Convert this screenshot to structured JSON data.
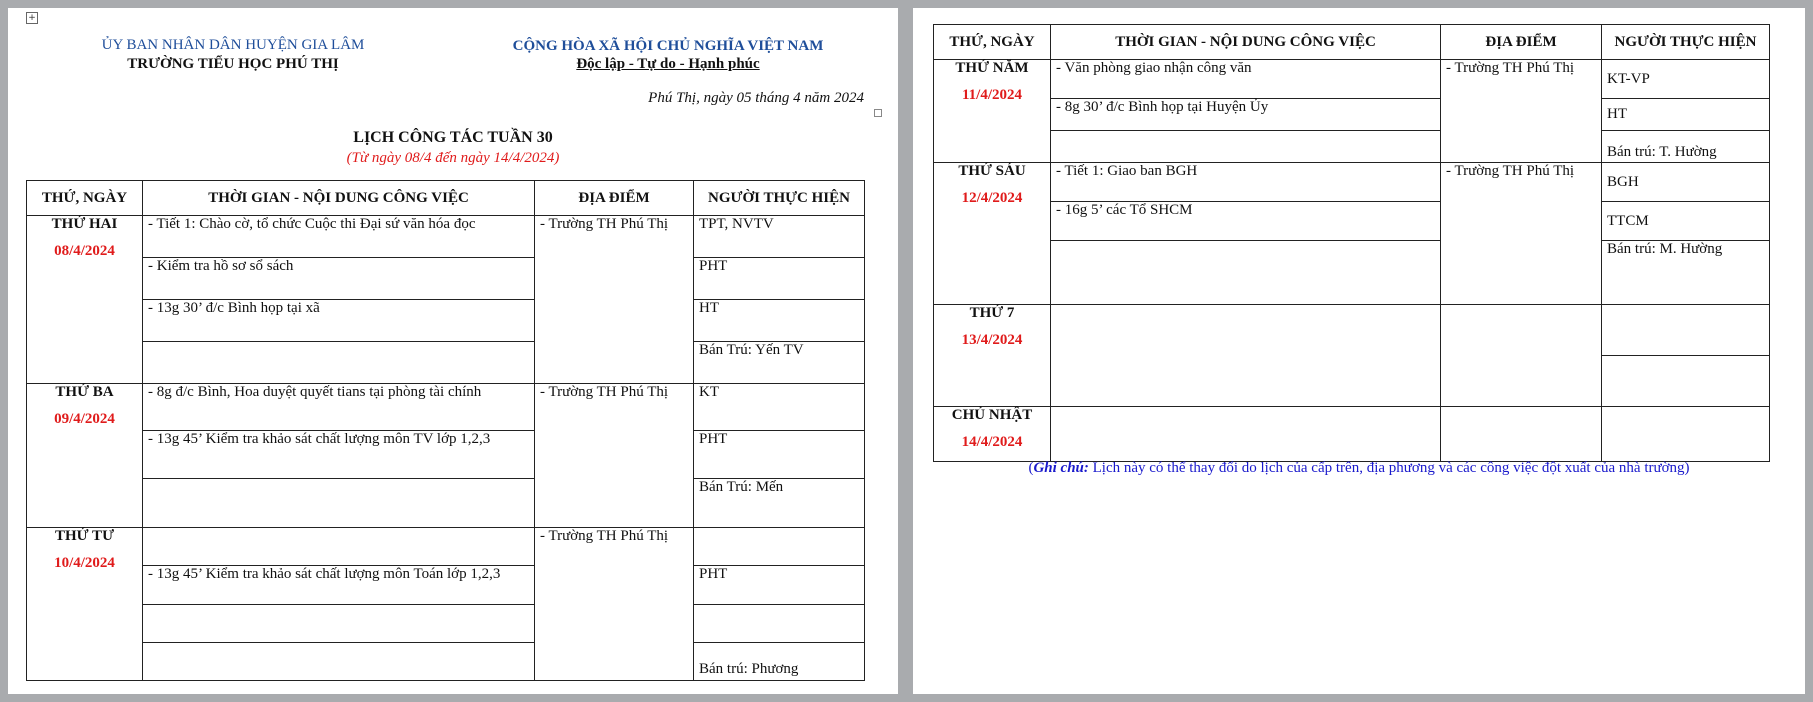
{
  "header": {
    "left_line1": "ỦY BAN NHÂN DÂN HUYỆN GIA LÂM",
    "left_line2": "TRƯỜNG TIỂU HỌC PHÚ THỊ",
    "right_line1": "CỘNG HÒA XÃ HỘI CHỦ NGHĨA VIỆT NAM",
    "right_line2": "Độc lập - Tự do - Hạnh phúc",
    "date_line": "Phú Thị, ngày  05 tháng  4   năm 2024"
  },
  "title": "LỊCH CÔNG TÁC TUẦN 30",
  "subtitle": "(Từ ngày 08/4 đến ngày 14/4/2024)",
  "columns": [
    "THỨ, NGÀY",
    "THỜI GIAN - NỘI DUNG CÔNG VIỆC",
    "ĐỊA ĐIỂM",
    "NGƯỜI THỰC HIỆN"
  ],
  "days": {
    "mon": {
      "name": "THỨ HAI",
      "date": "08/4/2024",
      "location": "- Trường TH Phú Thị",
      "rows": [
        {
          "task": "- Tiết 1: Chào cờ, tổ chức Cuộc thi Đại sứ văn hóa đọc",
          "person": "TPT, NVTV"
        },
        {
          "task": "- Kiểm tra hồ sơ sổ sách",
          "person": "PHT"
        },
        {
          "task": "- 13g 30’ đ/c Bình họp tại xã",
          "person": "HT"
        },
        {
          "task": "",
          "person": "Bán Trú: Yến TV"
        }
      ]
    },
    "tue": {
      "name": "THỨ BA",
      "date": "09/4/2024",
      "location": "- Trường TH Phú Thị",
      "rows": [
        {
          "task": "- 8g đ/c Bình, Hoa duyệt quyết tians tại phòng tài chính",
          "person": "KT"
        },
        {
          "task": "- 13g 45’ Kiểm tra khảo sát chất lượng môn TV lớp 1,2,3",
          "person": "PHT"
        },
        {
          "task": "",
          "person": "Bán Trú: Mến"
        }
      ]
    },
    "wed": {
      "name": "THỨ TƯ",
      "date": "10/4/2024",
      "location": "- Trường TH Phú Thị",
      "rows": [
        {
          "task": "",
          "person": ""
        },
        {
          "task": "- 13g 45’ Kiểm tra khảo sát chất lượng môn Toán lớp 1,2,3",
          "person": "PHT"
        },
        {
          "task": "",
          "person": ""
        },
        {
          "task": "",
          "person": "Bán trú: Phương"
        }
      ]
    },
    "thu": {
      "name": "THỨ NĂM",
      "date": "11/4/2024",
      "location": "- Trường TH Phú Thị",
      "rows": [
        {
          "task": "- Văn phòng giao nhận công văn",
          "person": "KT-VP"
        },
        {
          "task": "- 8g 30’ đ/c Bình họp tại Huyện Ủy",
          "person": "HT"
        },
        {
          "task": "",
          "person": "Bán trú: T. Hường"
        }
      ]
    },
    "fri": {
      "name": "THỨ SÁU",
      "date": "12/4/2024",
      "location": "- Trường TH Phú Thị",
      "rows": [
        {
          "task": "- Tiết 1: Giao ban BGH",
          "person": "BGH"
        },
        {
          "task": "- 16g 5’ các Tổ SHCM",
          "person": "TTCM"
        },
        {
          "task": "",
          "person": "Bán trú: M. Hường"
        }
      ]
    },
    "sat": {
      "name": "THỨ 7",
      "date": "13/4/2024"
    },
    "sun": {
      "name": "CHỦ NHẬT",
      "date": "14/4/2024"
    }
  },
  "note": {
    "label": "Ghi chú:",
    "text": " Lịch này có thể thay đổi do lịch của cấp trên, địa phương và các công việc đột xuất của nhà trường)"
  }
}
